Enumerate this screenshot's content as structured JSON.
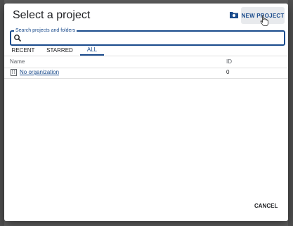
{
  "dialog": {
    "title": "Select a project",
    "new_project_label": "NEW PROJECT",
    "cancel_label": "CANCEL"
  },
  "search": {
    "label": "Search projects and folders",
    "value": ""
  },
  "tabs": [
    {
      "label": "RECENT",
      "active": false
    },
    {
      "label": "STARRED",
      "active": false
    },
    {
      "label": "ALL",
      "active": true
    }
  ],
  "table": {
    "headers": {
      "name": "Name",
      "id": "ID"
    },
    "rows": [
      {
        "name": "No organization",
        "id": "0",
        "icon": "building-icon"
      }
    ]
  },
  "colors": {
    "accent": "#1a4b8c",
    "overlay": "#5e5e5e"
  }
}
